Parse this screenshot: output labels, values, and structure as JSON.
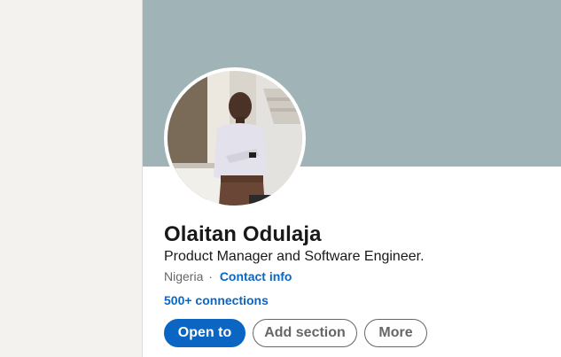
{
  "profile": {
    "name": "Olaitan Odulaja",
    "headline": "Product Manager and Software Engineer.",
    "location": "Nigeria",
    "separator": "·",
    "contact_info": "Contact info",
    "connections": "500+ connections"
  },
  "actions": {
    "open_to": "Open to",
    "add_section": "Add section",
    "more": "More"
  },
  "colors": {
    "banner": "#a0b4b7",
    "link": "#0a66c2",
    "primary_button": "#0a66c2",
    "page_background": "#f3f2ef"
  }
}
